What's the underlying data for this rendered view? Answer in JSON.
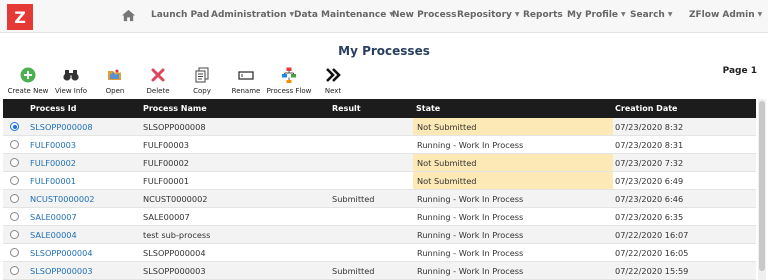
{
  "app": {
    "logo": "Z"
  },
  "nav": [
    {
      "label": "Launch Pad",
      "dropdown": false
    },
    {
      "label": "Administration",
      "dropdown": true
    },
    {
      "label": "Data Maintenance",
      "dropdown": true
    },
    {
      "label": "New Process",
      "dropdown": false
    },
    {
      "label": "Repository",
      "dropdown": true
    },
    {
      "label": "Reports",
      "dropdown": false
    },
    {
      "label": "My Profile",
      "dropdown": true
    },
    {
      "label": "Search",
      "dropdown": true
    },
    {
      "label": "ZFlow Admin",
      "dropdown": true
    }
  ],
  "page": {
    "title": "My Processes",
    "page_label": "Page 1"
  },
  "toolbar": [
    {
      "label": "Create New",
      "icon": "plus-circle-icon"
    },
    {
      "label": "View Info",
      "icon": "binoculars-icon"
    },
    {
      "label": "Open",
      "icon": "open-folder-icon"
    },
    {
      "label": "Delete",
      "icon": "delete-x-icon"
    },
    {
      "label": "Copy",
      "icon": "copy-icon"
    },
    {
      "label": "Rename",
      "icon": "rename-icon"
    },
    {
      "label": "Process Flow",
      "icon": "process-flow-icon"
    },
    {
      "label": "Next",
      "icon": "next-arrow-icon"
    }
  ],
  "table": {
    "columns": [
      "Process Id",
      "Process Name",
      "Result",
      "State",
      "Creation Date"
    ],
    "rows": [
      {
        "id": "SLSOPP000008",
        "name": "SLSOPP000008",
        "result": "",
        "state": "Not Submitted",
        "date": "07/23/2020 8:32",
        "selected": true
      },
      {
        "id": "FULF00003",
        "name": "FULF00003",
        "result": "",
        "state": "Running - Work In Process",
        "date": "07/23/2020 8:31",
        "selected": false
      },
      {
        "id": "FULF00002",
        "name": "FULF00002",
        "result": "",
        "state": "Not Submitted",
        "date": "07/23/2020 7:32",
        "selected": false
      },
      {
        "id": "FULF00001",
        "name": "FULF00001",
        "result": "",
        "state": "Not Submitted",
        "date": "07/23/2020 6:49",
        "selected": false
      },
      {
        "id": "NCUST0000002",
        "name": "NCUST0000002",
        "result": "Submitted",
        "state": "Running - Work In Process",
        "date": "07/23/2020 6:46",
        "selected": false
      },
      {
        "id": "SALE00007",
        "name": "SALE00007",
        "result": "",
        "state": "Running - Work In Process",
        "date": "07/23/2020 6:35",
        "selected": false
      },
      {
        "id": "SALE00004",
        "name": "test sub-process",
        "result": "",
        "state": "Running - Work In Process",
        "date": "07/22/2020 16:07",
        "selected": false
      },
      {
        "id": "SLSOPP000004",
        "name": "SLSOPP000004",
        "result": "",
        "state": "Running - Work In Process",
        "date": "07/22/2020 16:05",
        "selected": false
      },
      {
        "id": "SLSOPP000003",
        "name": "SLSOPP000003",
        "result": "Submitted",
        "state": "Running - Work In Process",
        "date": "07/22/2020 15:59",
        "selected": false
      }
    ]
  },
  "colors": {
    "accent": "#1f6fb5",
    "not_submitted_bg": "#fde9b6",
    "logo_red": "#e53935",
    "header_bg": "#1c1c1c"
  }
}
